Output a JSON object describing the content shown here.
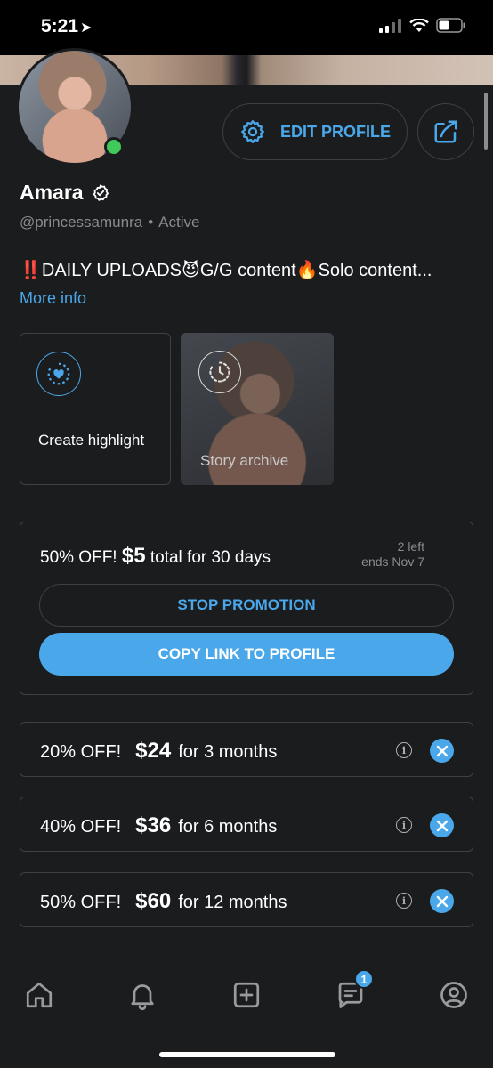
{
  "status_bar": {
    "time": "5:21",
    "location_glyph": "➤"
  },
  "profile": {
    "name": "Amara",
    "handle": "@princessamunra",
    "status": "Active",
    "bio": "‼️DAILY UPLOADS😈G/G content🔥Solo content...",
    "more_info": "More info",
    "edit_profile_label": "EDIT PROFILE",
    "online": true
  },
  "highlights": {
    "create_label": "Create highlight",
    "archive_label": "Story archive"
  },
  "promotion": {
    "discount": "50% OFF!",
    "price": "$5",
    "terms": "total for 30 days",
    "left": "2 left",
    "ends": "ends Nov 7",
    "stop_label": "STOP PROMOTION",
    "copy_label": "COPY LINK TO PROFILE"
  },
  "bundles": [
    {
      "discount": "20% OFF!",
      "price": "$24",
      "duration": "for 3 months"
    },
    {
      "discount": "40% OFF!",
      "price": "$36",
      "duration": "for 6 months"
    },
    {
      "discount": "50% OFF!",
      "price": "$60",
      "duration": "for 12 months"
    }
  ],
  "tabbar": {
    "items": [
      "home-icon",
      "bell-icon",
      "add-post-icon",
      "messages-icon",
      "profile-icon"
    ],
    "messages_badge": "1"
  },
  "colors": {
    "accent": "#4aa8ea",
    "background": "#1b1c1e",
    "border": "#3e4043",
    "online": "#41c95b"
  }
}
